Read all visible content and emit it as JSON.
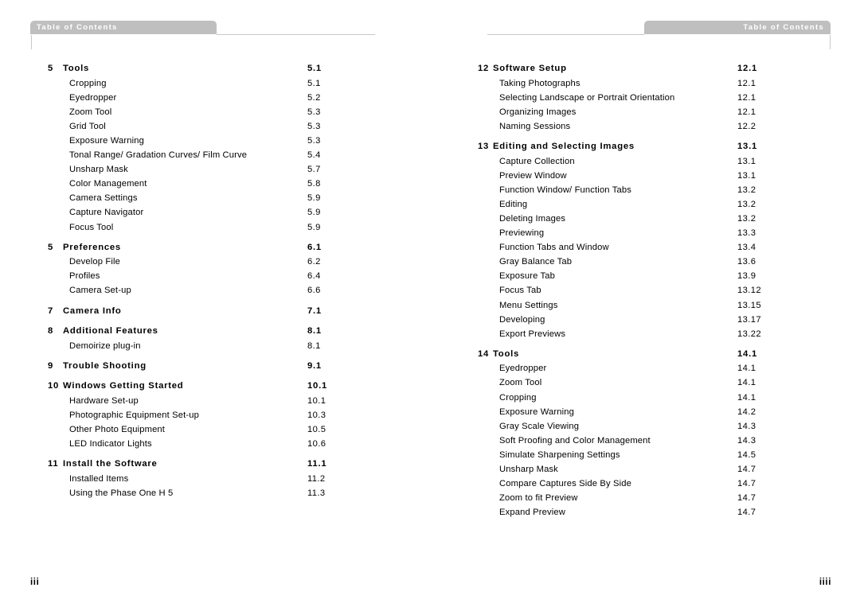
{
  "header": {
    "left_tab_label": "Table of Contents",
    "right_tab_label": "Table of Contents"
  },
  "footer": {
    "left_page_number": "iii",
    "right_page_number": "iiii"
  },
  "colors": {
    "tab_background": "#bfbfbf",
    "tab_text": "#ffffff",
    "rule": "#c8c8c8",
    "body_text": "#000000",
    "page_background": "#ffffff"
  },
  "columns": [
    {
      "name": "left-column",
      "rows": [
        {
          "type": "heading",
          "num": "5",
          "title": "Tools",
          "page": "5.1"
        },
        {
          "type": "entry",
          "num": "",
          "title": "Cropping",
          "page": "5.1"
        },
        {
          "type": "entry",
          "num": "",
          "title": "Eyedropper",
          "page": "5.2"
        },
        {
          "type": "entry",
          "num": "",
          "title": "Zoom Tool",
          "page": "5.3"
        },
        {
          "type": "entry",
          "num": "",
          "title": "Grid Tool",
          "page": "5.3"
        },
        {
          "type": "entry",
          "num": "",
          "title": "Exposure Warning",
          "page": "5.3"
        },
        {
          "type": "entry",
          "num": "",
          "title": "Tonal Range/ Gradation Curves/ Film Curve",
          "page": "5.4"
        },
        {
          "type": "entry",
          "num": "",
          "title": "Unsharp Mask",
          "page": "5.7"
        },
        {
          "type": "entry",
          "num": "",
          "title": "Color Management",
          "page": "5.8"
        },
        {
          "type": "entry",
          "num": "",
          "title": "Camera Settings",
          "page": "5.9"
        },
        {
          "type": "entry",
          "num": "",
          "title": "Capture Navigator",
          "page": "5.9"
        },
        {
          "type": "entry",
          "num": "",
          "title": "Focus Tool",
          "page": "5.9"
        },
        {
          "type": "heading",
          "num": "5",
          "title": "Preferences",
          "page": "6.1"
        },
        {
          "type": "entry",
          "num": "",
          "title": "Develop File",
          "page": "6.2"
        },
        {
          "type": "entry",
          "num": "",
          "title": "Profiles",
          "page": "6.4"
        },
        {
          "type": "entry",
          "num": "",
          "title": "Camera Set-up",
          "page": "6.6"
        },
        {
          "type": "heading",
          "num": "7",
          "title": "Camera Info",
          "page": "7.1"
        },
        {
          "type": "heading",
          "num": "8",
          "title": "Additional Features",
          "page": "8.1"
        },
        {
          "type": "entry",
          "num": "",
          "title": "Demoirize plug-in",
          "page": "8.1"
        },
        {
          "type": "heading",
          "num": "9",
          "title": "Trouble Shooting",
          "page": "9.1"
        },
        {
          "type": "heading",
          "num": "10",
          "title": "Windows Getting Started",
          "page": "10.1"
        },
        {
          "type": "entry",
          "num": "",
          "title": "Hardware Set-up",
          "page": "10.1"
        },
        {
          "type": "entry",
          "num": "",
          "title": "Photographic Equipment Set-up",
          "page": "10.3"
        },
        {
          "type": "entry",
          "num": "",
          "title": "Other Photo Equipment",
          "page": "10.5"
        },
        {
          "type": "entry",
          "num": "",
          "title": "LED Indicator Lights",
          "page": "10.6"
        },
        {
          "type": "heading",
          "num": "11",
          "title": "Install the Software",
          "page": "11.1"
        },
        {
          "type": "entry",
          "num": "",
          "title": "Installed Items",
          "page": "11.2"
        },
        {
          "type": "entry",
          "num": "",
          "title": "Using the Phase One H 5",
          "page": "11.3"
        }
      ]
    },
    {
      "name": "right-column",
      "rows": [
        {
          "type": "heading",
          "num": "12",
          "title": "Software Setup",
          "page": "12.1"
        },
        {
          "type": "entry",
          "num": "",
          "title": "Taking Photographs",
          "page": "12.1"
        },
        {
          "type": "entry",
          "num": "",
          "title": "Selecting Landscape or Portrait Orientation",
          "page": "12.1"
        },
        {
          "type": "entry",
          "num": "",
          "title": "Organizing Images",
          "page": "12.1"
        },
        {
          "type": "entry",
          "num": "",
          "title": "Naming Sessions",
          "page": "12.2"
        },
        {
          "type": "heading",
          "num": "13",
          "title": "Editing and Selecting Images",
          "page": "13.1"
        },
        {
          "type": "entry",
          "num": "",
          "title": "Capture Collection",
          "page": "13.1"
        },
        {
          "type": "entry",
          "num": "",
          "title": "Preview Window",
          "page": "13.1"
        },
        {
          "type": "entry",
          "num": "",
          "title": "Function Window/ Function Tabs",
          "page": "13.2"
        },
        {
          "type": "entry",
          "num": "",
          "title": "Editing",
          "page": "13.2"
        },
        {
          "type": "entry",
          "num": "",
          "title": "Deleting Images",
          "page": "13.2"
        },
        {
          "type": "entry",
          "num": "",
          "title": "Previewing",
          "page": "13.3"
        },
        {
          "type": "entry",
          "num": "",
          "title": "Function Tabs and Window",
          "page": "13.4"
        },
        {
          "type": "entry",
          "num": "",
          "title": "Gray Balance Tab",
          "page": "13.6"
        },
        {
          "type": "entry",
          "num": "",
          "title": "Exposure Tab",
          "page": "13.9"
        },
        {
          "type": "entry",
          "num": "",
          "title": "Focus Tab",
          "page": "13.12"
        },
        {
          "type": "entry",
          "num": "",
          "title": "Menu Settings",
          "page": "13.15"
        },
        {
          "type": "entry",
          "num": "",
          "title": "Developing",
          "page": "13.17"
        },
        {
          "type": "entry",
          "num": "",
          "title": "Export Previews",
          "page": "13.22"
        },
        {
          "type": "heading",
          "num": "14",
          "title": "Tools",
          "page": "14.1"
        },
        {
          "type": "entry",
          "num": "",
          "title": "Eyedropper",
          "page": "14.1"
        },
        {
          "type": "entry",
          "num": "",
          "title": "Zoom Tool",
          "page": "14.1"
        },
        {
          "type": "entry",
          "num": "",
          "title": "Cropping",
          "page": "14.1"
        },
        {
          "type": "entry",
          "num": "",
          "title": "Exposure Warning",
          "page": "14.2"
        },
        {
          "type": "entry",
          "num": "",
          "title": "Gray Scale Viewing",
          "page": "14.3"
        },
        {
          "type": "entry",
          "num": "",
          "title": "Soft Proofing and Color Management",
          "page": "14.3"
        },
        {
          "type": "entry",
          "num": "",
          "title": "Simulate Sharpening Settings",
          "page": "14.5"
        },
        {
          "type": "entry",
          "num": "",
          "title": "Unsharp Mask",
          "page": "14.7"
        },
        {
          "type": "entry",
          "num": "",
          "title": "Compare Captures Side By Side",
          "page": "14.7"
        },
        {
          "type": "entry",
          "num": "",
          "title": "Zoom to fit Preview",
          "page": "14.7"
        },
        {
          "type": "entry",
          "num": "",
          "title": "Expand Preview",
          "page": "14.7"
        }
      ]
    }
  ]
}
